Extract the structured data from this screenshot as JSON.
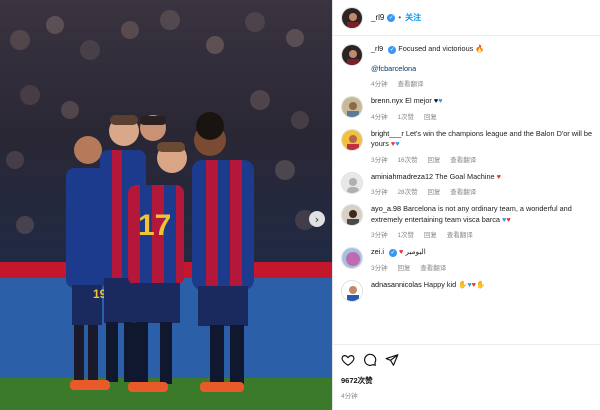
{
  "post": {
    "author": "_rl9",
    "follow_label": "关注",
    "separator": "•",
    "caption_text": "Focused and victorious",
    "caption_tag": "@fcbarcelona",
    "caption_time": "4分钟",
    "caption_translate": "查看翻译",
    "likes": "9672次赞",
    "age": "4分钟"
  },
  "comments": [
    {
      "user": "brenn.nyx",
      "text": "El mejor",
      "emoji": [
        "🖤",
        "💙"
      ],
      "time": "4分钟",
      "likes": "1次赞",
      "reply": "回复",
      "translate": ""
    },
    {
      "user": "bright___r",
      "text": "Let's win the champions league and the Balon D'or will be yours",
      "emoji": [
        "❤️",
        "💙"
      ],
      "time": "3分钟",
      "likes": "16次赞",
      "reply": "回复",
      "translate": "查看翻译"
    },
    {
      "user": "aminiahmadreza12",
      "text": "The Goal Machine",
      "emoji": [
        "❤️"
      ],
      "time": "3分钟",
      "likes": "28次赞",
      "reply": "回复",
      "translate": "查看翻译"
    },
    {
      "user": "ayo_a.98",
      "text": "Barcelona is not any ordinary team, a wonderful and extremely entertaining team visca barca",
      "emoji": [
        "💙",
        "❤️"
      ],
      "time": "3分钟",
      "likes": "1次赞",
      "reply": "回复",
      "translate": "查看翻译"
    },
    {
      "user": "zei.i",
      "text": "البومبر",
      "emoji": [
        "❤️‍🔥"
      ],
      "time": "3分钟",
      "likes": "",
      "reply": "回复",
      "translate": "查看翻译"
    },
    {
      "user": "adnasannicolas",
      "text": "Happy kid",
      "emoji": [
        "💙",
        "❤️",
        "💙",
        "❤️"
      ],
      "time": "",
      "likes": "",
      "reply": "",
      "translate": ""
    }
  ],
  "icons": {
    "heart": "heart-icon",
    "comment": "comment-icon",
    "share": "share-icon",
    "next": "chevron-right-icon",
    "verified": "verified-icon"
  },
  "colors": {
    "follow": "#0095f6",
    "verified": "#3897f0",
    "heart": "#e23636",
    "link": "#00376b",
    "pitch": "#3a7a2a",
    "barca_blue": "#1d3b8c",
    "barca_red": "#b3183a"
  }
}
